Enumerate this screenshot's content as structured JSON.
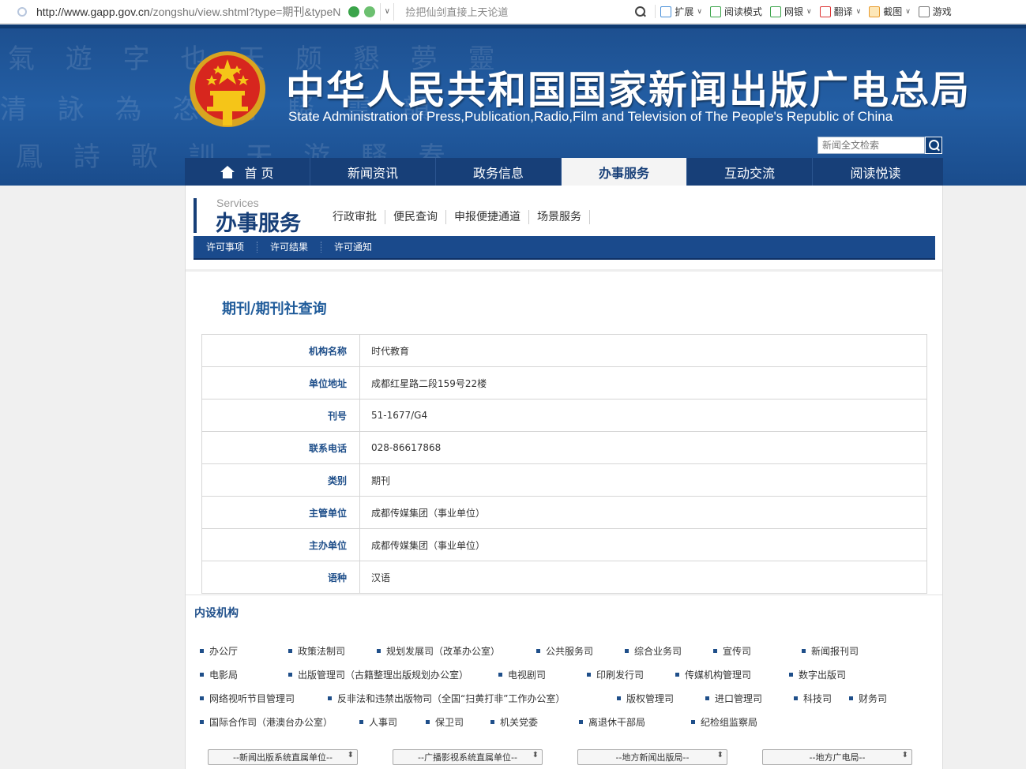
{
  "browser": {
    "url_host": "http://www.gapp.gov.cn",
    "url_path": "/zongshu/view.shtml?type=期刊&typeN",
    "search_hint": "捡把仙剑直接上天论道",
    "tools": [
      "扩展",
      "阅读模式",
      "网银",
      "翻译",
      "截图",
      "游戏"
    ]
  },
  "site": {
    "title": "中华人民共和国国家新闻出版广电总局",
    "subtitle": "State Administration of Press,Publication,Radio,Film and Television of The People's Republic of China",
    "search_placeholder": "新闻全文检索",
    "watermark": [
      "氣 遊 字 也 天 颇 懇 夢 靈",
      "清 詠 為 恣 朗 騷 雲 韻",
      "鳳 詩 歌 訓 天 游 騷 春"
    ]
  },
  "nav": {
    "items": [
      {
        "label": "首 页"
      },
      {
        "label": "新闻资讯"
      },
      {
        "label": "政务信息"
      },
      {
        "label": "办事服务"
      },
      {
        "label": "互动交流"
      },
      {
        "label": "阅读悦读"
      }
    ],
    "active": "办事服务"
  },
  "services": {
    "en": "Services",
    "cn": "办事服务",
    "subnav": [
      "行政审批",
      "便民查询",
      "申报便捷通道",
      "场景服务"
    ],
    "tertiary": [
      "许可事项",
      "许可结果",
      "许可通知"
    ]
  },
  "record": {
    "title": "期刊/期刊社查询",
    "rows": [
      {
        "label": "机构名称",
        "value": "时代教育"
      },
      {
        "label": "单位地址",
        "value": "成都红星路二段159号22楼"
      },
      {
        "label": "刊号",
        "value": "51-1677/G4"
      },
      {
        "label": "联系电话",
        "value": "028-86617868"
      },
      {
        "label": "类别",
        "value": "期刊"
      },
      {
        "label": "主管单位",
        "value": "成都传媒集团（事业单位）"
      },
      {
        "label": "主办单位",
        "value": "成都传媒集团（事业单位）"
      },
      {
        "label": "语种",
        "value": "汉语"
      }
    ]
  },
  "departments": {
    "title": "内设机构",
    "rows": [
      [
        "办公厅",
        "政策法制司",
        "规划发展司（改革办公室）",
        "公共服务司",
        "综合业务司",
        "宣传司",
        "新闻报刊司"
      ],
      [
        "电影局",
        "出版管理司（古籍整理出版规划办公室）",
        "电视剧司",
        "印刷发行司",
        "传媒机构管理司",
        "数字出版司"
      ],
      [
        "网络视听节目管理司",
        "反非法和违禁出版物司（全国“扫黄打非”工作办公室）",
        "版权管理司",
        "进口管理司",
        "科技司",
        "财务司"
      ],
      [
        "国际合作司（港澳台办公室）",
        "人事司",
        "保卫司",
        "机关党委",
        "离退休干部局",
        "纪检组监察局"
      ]
    ],
    "selects": [
      "--新闻出版系统直属单位--",
      "--广播影视系统直属单位--",
      "--地方新闻出版局--",
      "--地方广电局--"
    ]
  },
  "colors": {
    "nav_bg": "#173f78",
    "banner": "#235ea4",
    "label_blue": "#1f4f8a"
  }
}
